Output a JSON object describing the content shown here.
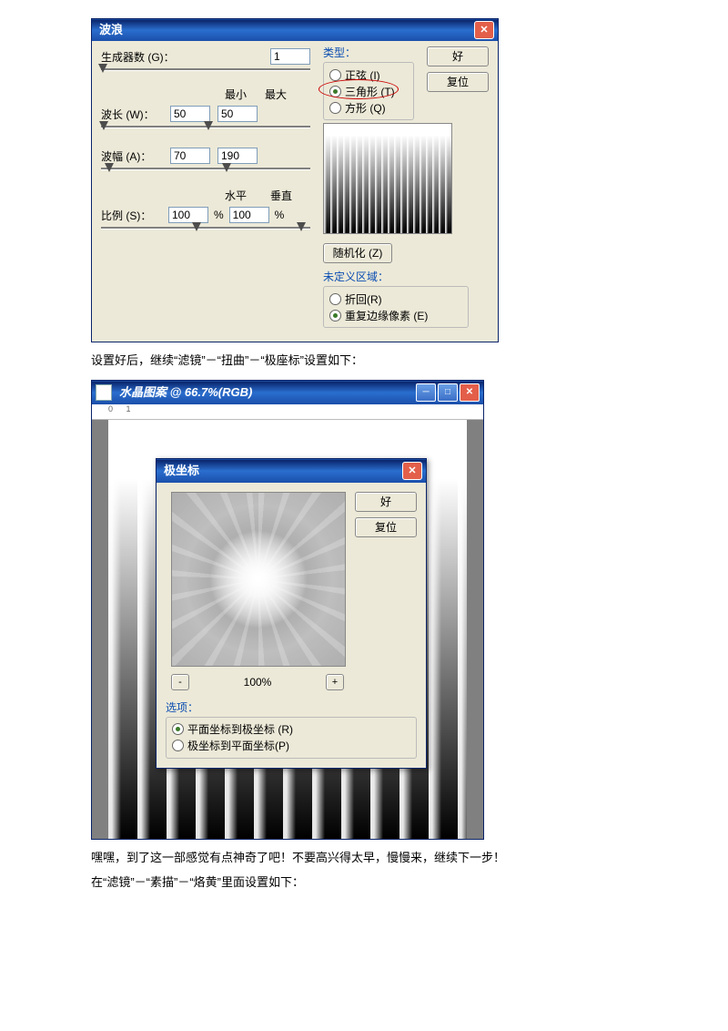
{
  "wave_dialog": {
    "title": "波浪",
    "generators_label": "生成器数 (G)：",
    "generators_value": "1",
    "min_label": "最小",
    "max_label": "最大",
    "wavelength_label": "波长 (W)：",
    "wavelength_min": "50",
    "wavelength_max": "50",
    "amplitude_label": "波幅 (A)：",
    "amplitude_min": "70",
    "amplitude_max": "190",
    "horiz_label": "水平",
    "vert_label": "垂直",
    "scale_label": "比例 (S)：",
    "scale_h": "100",
    "scale_v": "100",
    "percent": "%",
    "type_title": "类型：",
    "type_sine": "正弦 (I)",
    "type_triangle": "三角形  (T)",
    "type_square": "方形 (Q)",
    "ok_btn": "好",
    "reset_btn": "复位",
    "randomize_btn": "随机化 (Z)",
    "undefined_title": "未定义区域：",
    "undefined_wrap": "折回(R)",
    "undefined_repeat": "重复边缘像素 (E)"
  },
  "caption1": "设置好后，继续“滤镜”－“扭曲”－“极座标”设置如下：",
  "doc_window": {
    "title": "水晶图案 @ 66.7%(RGB)",
    "ruler": "0    1"
  },
  "polar_dialog": {
    "title": "极坐标",
    "ok_btn": "好",
    "reset_btn": "复位",
    "zoom_minus": "-",
    "zoom_value": "100%",
    "zoom_plus": "+",
    "options_title": "选项：",
    "opt_rect_to_polar": "平面坐标到极坐标 (R)",
    "opt_polar_to_rect": "极坐标到平面坐标(P)"
  },
  "caption2": "嘿嘿，到了这一部感觉有点神奇了吧！不要高兴得太早，慢慢来，继续下一步！",
  "caption3": "在“滤镜”－“素描”－“烙黄”里面设置如下："
}
